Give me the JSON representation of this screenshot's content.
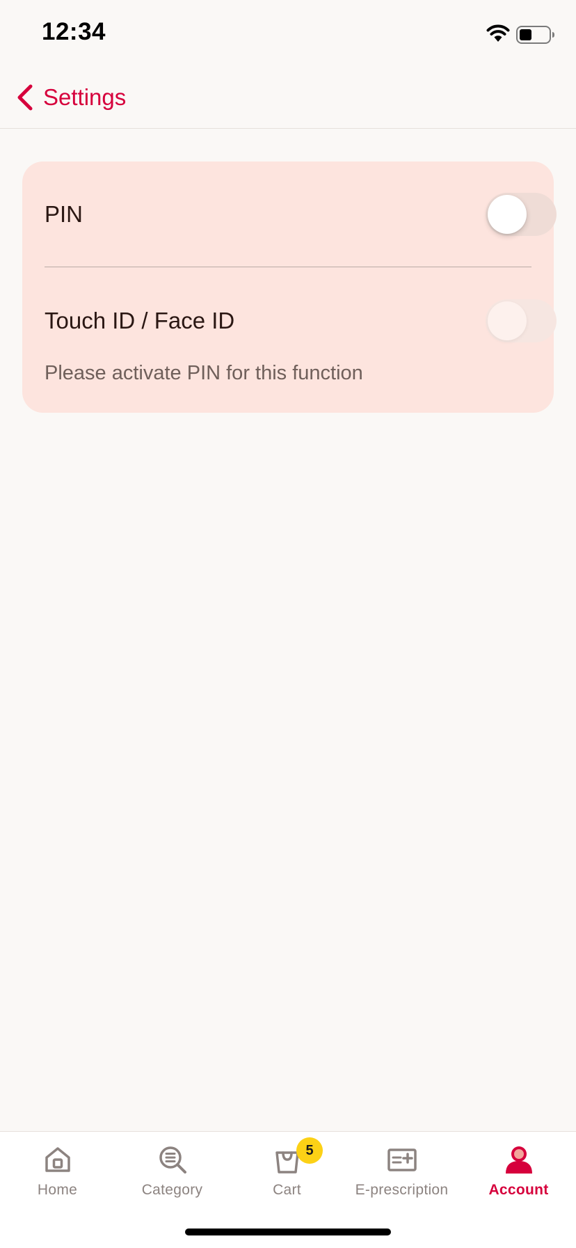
{
  "status_bar": {
    "time": "12:34",
    "icons": [
      "wifi-icon",
      "battery-icon"
    ]
  },
  "nav": {
    "back_label": "Settings",
    "back_icon": "chevron-left-icon"
  },
  "settings": {
    "pin": {
      "label": "PIN",
      "enabled": false
    },
    "biometric": {
      "label": "Touch ID / Face ID",
      "enabled": false,
      "disabled": true
    },
    "helper_text": "Please activate PIN for this function"
  },
  "tab_bar": {
    "tabs": [
      {
        "label": "Home",
        "icon": "home-icon",
        "active": false
      },
      {
        "label": "Category",
        "icon": "category-search-icon",
        "active": false
      },
      {
        "label": "Cart",
        "icon": "shopping-bag-icon",
        "active": false,
        "badge": "5"
      },
      {
        "label": "E-prescription",
        "icon": "prescription-icon",
        "active": false
      },
      {
        "label": "Account",
        "icon": "user-icon",
        "active": true
      }
    ]
  },
  "colors": {
    "accent": "#d6003c",
    "card_background": "#fde4de",
    "badge": "#fcd116",
    "page_background": "#faf8f6"
  }
}
